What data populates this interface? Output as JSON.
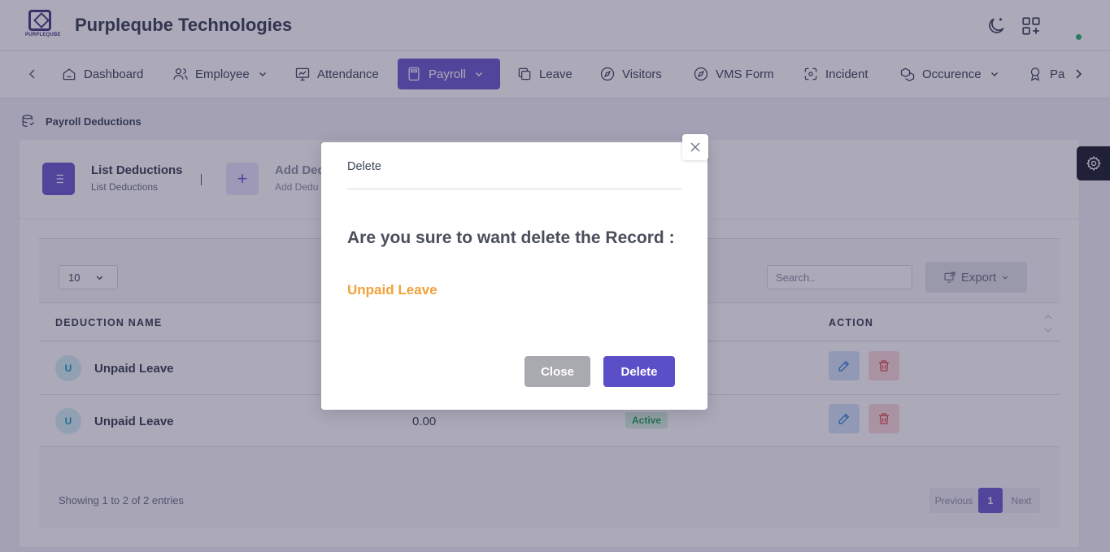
{
  "header": {
    "brand": "Purpleqube Technologies",
    "logo_text": "PURPLEQUBE"
  },
  "nav": {
    "items": [
      {
        "label": "Dashboard",
        "icon": "home-icon"
      },
      {
        "label": "Employee",
        "icon": "users-icon",
        "dropdown": true
      },
      {
        "label": "Attendance",
        "icon": "monitor-chart-icon"
      },
      {
        "label": "Payroll",
        "icon": "calculator-icon",
        "dropdown": true,
        "active": true
      },
      {
        "label": "Leave",
        "icon": "copy-icon"
      },
      {
        "label": "Visitors",
        "icon": "compass-icon"
      },
      {
        "label": "VMS Form",
        "icon": "compass-icon"
      },
      {
        "label": "Incident",
        "icon": "focus-icon"
      },
      {
        "label": "Occurence",
        "icon": "boxes-icon",
        "dropdown": true
      },
      {
        "label": "Pa",
        "icon": "award-icon"
      }
    ]
  },
  "breadcrumb": "Payroll Deductions",
  "tabs": {
    "list_title": "List Deductions",
    "list_sub": "List Deductions",
    "add_title": "Add Ded",
    "add_sub": "Add Dedu"
  },
  "table": {
    "page_size": "10",
    "search_placeholder": "Search..",
    "export_label": "Export",
    "headers": {
      "name": "DEDUCTION NAME",
      "action": "ACTION"
    },
    "rows": [
      {
        "avatar": "U",
        "name": "Unpaid Leave",
        "amount": "",
        "status": ""
      },
      {
        "avatar": "U",
        "name": "Unpaid Leave",
        "amount": "0.00",
        "status": "Active"
      }
    ],
    "showing": "Showing 1 to 2 of 2 entries",
    "pager": {
      "prev": "Previous",
      "current": "1",
      "next": "Next"
    }
  },
  "modal": {
    "title": "Delete",
    "question": "Are you sure to want delete the Record :",
    "record": "Unpaid Leave",
    "close_label": "Close",
    "delete_label": "Delete"
  },
  "colors": {
    "accent": "#6c5ecf",
    "record_highlight": "#f1a13a",
    "status_active": "#25a65c"
  }
}
